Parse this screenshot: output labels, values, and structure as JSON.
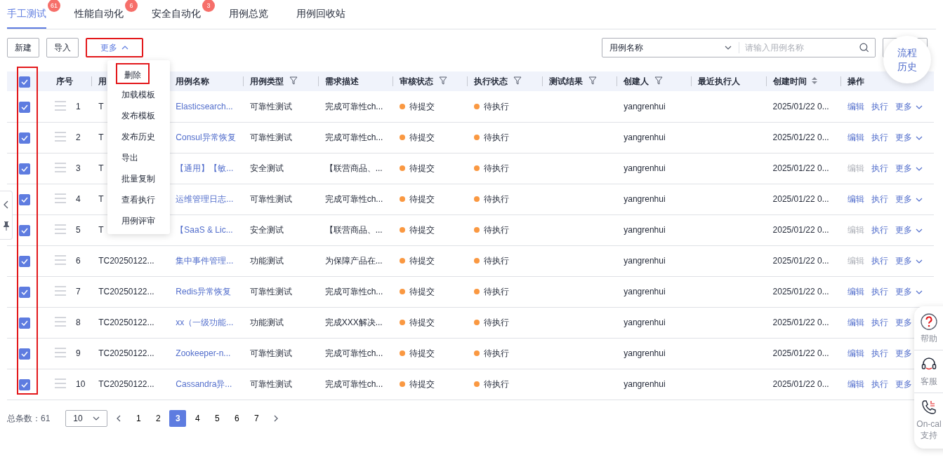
{
  "tabs": [
    {
      "label": "手工测试",
      "badge": "61",
      "selected": true
    },
    {
      "label": "性能自动化",
      "badge": "6",
      "selected": false
    },
    {
      "label": "安全自动化",
      "badge": "3",
      "selected": false
    },
    {
      "label": "用例总览",
      "selected": false
    },
    {
      "label": "用例回收站",
      "selected": false
    }
  ],
  "toolbar": {
    "buttons": [
      {
        "label": "新建"
      },
      {
        "label": "导入"
      }
    ],
    "more_button": {
      "label": "更多",
      "expanded": true,
      "highlighted": true
    },
    "search": {
      "field": "用例名称",
      "placeholder": "请输入用例名称"
    }
  },
  "more_menu": [
    {
      "label": "删除",
      "highlighted": true
    },
    {
      "label": "加载模板",
      "highlighted": false
    },
    {
      "label": "发布模板",
      "highlighted": false
    },
    {
      "label": "发布历史",
      "highlighted": false
    },
    {
      "label": "导出",
      "highlighted": false
    },
    {
      "label": "批量复制",
      "highlighted": false
    },
    {
      "label": "查看执行",
      "highlighted": false
    },
    {
      "label": "用例评审",
      "highlighted": false
    }
  ],
  "float_button": "流程历史",
  "table": {
    "select_all_checked": true,
    "checkbox_column_highlighted": true,
    "columns": [
      {
        "label": "序号"
      },
      {
        "label": "用"
      },
      {
        "label": "用例名称"
      },
      {
        "label": "用例类型",
        "filter": true
      },
      {
        "label": "需求描述"
      },
      {
        "label": "审核状态",
        "filter": true
      },
      {
        "label": "执行状态",
        "filter": true
      },
      {
        "label": "测试结果",
        "filter": true
      },
      {
        "label": "创建人",
        "filter": true
      },
      {
        "label": "最近执行人"
      },
      {
        "label": "创建时间",
        "sort": true
      },
      {
        "label": "操作"
      }
    ],
    "rows": [
      {
        "checked": true,
        "index": "1",
        "id": "T",
        "name": "Elasticsearch...",
        "type": "可靠性测试",
        "desc": "完成可靠性ch...",
        "review": "待提交",
        "exec": "待执行",
        "creator": "yangrenhui",
        "created": "2025/01/22 0...",
        "actions": [
          "编辑",
          "执行",
          "更多"
        ],
        "edit_disabled": false,
        "more_caret": true
      },
      {
        "checked": true,
        "index": "2",
        "id": "T",
        "name": "Consul异常恢复",
        "type": "可靠性测试",
        "desc": "完成可靠性ch...",
        "review": "待提交",
        "exec": "待执行",
        "creator": "yangrenhui",
        "created": "2025/01/22 0...",
        "actions": [
          "编辑",
          "执行",
          "更多"
        ],
        "edit_disabled": false,
        "more_caret": true
      },
      {
        "checked": true,
        "index": "3",
        "id": "T",
        "name": "【通用】【敏...",
        "type": "安全测试",
        "desc": "【联营商品、...",
        "review": "待提交",
        "exec": "待执行",
        "creator": "yangrenhui",
        "created": "2025/01/22 0...",
        "actions": [
          "编辑",
          "执行",
          "更多"
        ],
        "edit_disabled": true,
        "more_caret": true
      },
      {
        "checked": true,
        "index": "4",
        "id": "T",
        "name": "运维管理日志...",
        "type": "可靠性测试",
        "desc": "完成可靠性ch...",
        "review": "待提交",
        "exec": "待执行",
        "creator": "yangrenhui",
        "created": "2025/01/22 0...",
        "actions": [
          "编辑",
          "执行",
          "更多"
        ],
        "edit_disabled": false,
        "more_caret": true
      },
      {
        "checked": true,
        "index": "5",
        "id": "T",
        "name": "【SaaS & Lic...",
        "type": "安全测试",
        "desc": "【联营商品、...",
        "review": "待提交",
        "exec": "待执行",
        "creator": "yangrenhui",
        "created": "2025/01/22 0...",
        "actions": [
          "编辑",
          "执行",
          "更多"
        ],
        "edit_disabled": true,
        "more_caret": true
      },
      {
        "checked": true,
        "index": "6",
        "id": "TC20250122...",
        "name": "集中事件管理...",
        "type": "功能测试",
        "desc": "为保障产品在...",
        "review": "待提交",
        "exec": "待执行",
        "creator": "yangrenhui",
        "created": "2025/01/22 0...",
        "actions": [
          "编辑",
          "执行",
          "更多"
        ],
        "edit_disabled": true,
        "more_caret": true
      },
      {
        "checked": true,
        "index": "7",
        "id": "TC20250122...",
        "name": "Redis异常恢复",
        "type": "可靠性测试",
        "desc": "完成可靠性ch...",
        "review": "待提交",
        "exec": "待执行",
        "creator": "yangrenhui",
        "created": "2025/01/22 0...",
        "actions": [
          "编辑",
          "执行",
          "更多"
        ],
        "edit_disabled": false,
        "more_caret": true
      },
      {
        "checked": true,
        "index": "8",
        "id": "TC20250122...",
        "name": "xx（一级功能...",
        "type": "功能测试",
        "desc": "完成XXX解决...",
        "review": "待提交",
        "exec": "待执行",
        "creator": "yangrenhui",
        "created": "2025/01/22 0...",
        "actions": [
          "编辑",
          "执行",
          "更多"
        ],
        "edit_disabled": false,
        "more_caret": false
      },
      {
        "checked": true,
        "index": "9",
        "id": "TC20250122...",
        "name": "Zookeeper-n...",
        "type": "可靠性测试",
        "desc": "完成可靠性ch...",
        "review": "待提交",
        "exec": "待执行",
        "creator": "yangrenhui",
        "created": "2025/01/22 0...",
        "actions": [
          "编辑",
          "执行",
          "更多"
        ],
        "edit_disabled": false,
        "more_caret": false
      },
      {
        "checked": true,
        "index": "10",
        "id": "TC20250122...",
        "name": "Cassandra异...",
        "type": "可靠性测试",
        "desc": "完成可靠性ch...",
        "review": "待提交",
        "exec": "待执行",
        "creator": "yangrenhui",
        "created": "2025/01/22 0...",
        "actions": [
          "编辑",
          "执行",
          "更多"
        ],
        "edit_disabled": false,
        "more_caret": false
      }
    ]
  },
  "pagination": {
    "total": "总条数：61",
    "page_size": "10",
    "pages": [
      {
        "label": "1",
        "selected": false
      },
      {
        "label": "2",
        "selected": false
      },
      {
        "label": "3",
        "selected": true
      },
      {
        "label": "4",
        "selected": false
      },
      {
        "label": "5",
        "selected": false
      },
      {
        "label": "6",
        "selected": false
      },
      {
        "label": "7",
        "selected": false
      }
    ]
  },
  "help_panel": [
    {
      "kind": "help",
      "label": "帮助"
    },
    {
      "kind": "service",
      "label": "客服"
    },
    {
      "kind": "oncall",
      "label": "On-cal\n支持"
    }
  ]
}
